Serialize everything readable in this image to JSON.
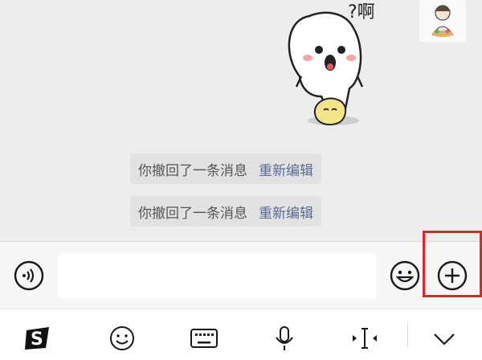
{
  "sticker": {
    "caption": "?啊",
    "icon": "shocked-blob-sticker"
  },
  "avatar": {
    "icon": "user-avatar"
  },
  "recall_messages": [
    {
      "text": "你撤回了一条消息",
      "action": "重新编辑"
    },
    {
      "text": "你撤回了一条消息",
      "action": "重新编辑"
    }
  ],
  "input_bar": {
    "voice_icon": "voice-icon",
    "input_value": "",
    "emoji_icon": "emoji-icon",
    "more_icon": "plus-circle-icon"
  },
  "keyboard_toolbar": {
    "items": [
      "sogou-logo-icon",
      "emoji-icon",
      "keyboard-icon",
      "microphone-icon",
      "cursor-move-icon",
      "collapse-chevron-icon"
    ]
  },
  "colors": {
    "highlight": "#e0242a",
    "link": "#576b95"
  }
}
